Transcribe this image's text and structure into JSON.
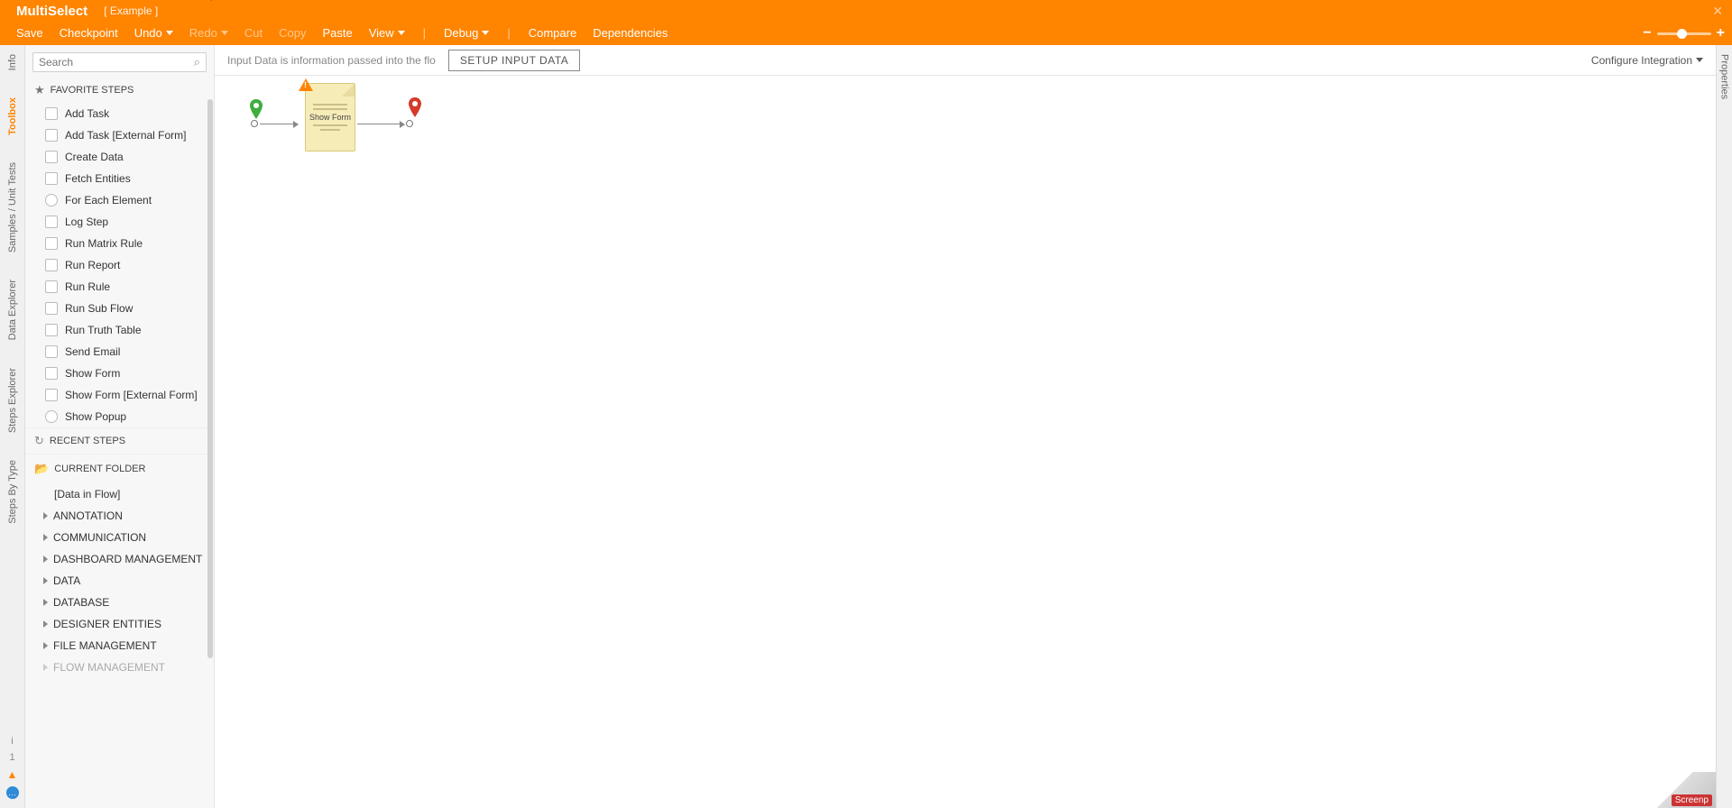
{
  "header": {
    "title": "MultiSelect",
    "subtitle": "[ Example ]"
  },
  "menu": {
    "save": "Save",
    "checkpoint": "Checkpoint",
    "undo": "Undo",
    "redo": "Redo",
    "cut": "Cut",
    "copy": "Copy",
    "paste": "Paste",
    "view": "View",
    "debug": "Debug",
    "compare": "Compare",
    "dependencies": "Dependencies"
  },
  "left_rail": {
    "tabs": [
      "Info",
      "Toolbox",
      "Samples / Unit Tests",
      "Data Explorer",
      "Steps Explorer",
      "Steps By Type"
    ],
    "bottom": {
      "info": "i",
      "count": "1",
      "chat": "…"
    }
  },
  "right_rail": {
    "tab": "Properties"
  },
  "search": {
    "placeholder": "Search"
  },
  "sections": {
    "favorite": "FAVORITE STEPS",
    "recent": "RECENT STEPS",
    "current": "CURRENT FOLDER"
  },
  "favorite_steps": [
    "Add Task",
    "Add Task [External Form]",
    "Create Data",
    "Fetch Entities",
    "For Each Element",
    "Log Step",
    "Run Matrix Rule",
    "Run Report",
    "Run Rule",
    "Run Sub Flow",
    "Run Truth Table",
    "Send Email",
    "Show Form",
    "Show Form [External Form]",
    "Show Popup"
  ],
  "folder_items": [
    "[Data in Flow]",
    "ANNOTATION",
    "COMMUNICATION",
    "DASHBOARD MANAGEMENT",
    "DATA",
    "DATABASE",
    "DESIGNER ENTITIES",
    "FILE MANAGEMENT",
    "FLOW MANAGEMENT"
  ],
  "canvas_bar": {
    "hint": "Input Data is information passed into the flo",
    "button": "SETUP INPUT DATA",
    "config": "Configure Integration"
  },
  "flow": {
    "node_label": "Show Form"
  },
  "corner_badge": "Screenp"
}
